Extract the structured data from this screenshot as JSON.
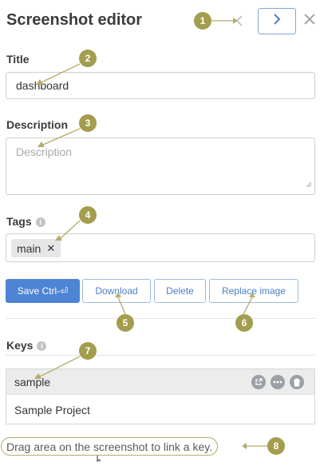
{
  "header": {
    "title": "Screenshot editor",
    "prev_icon": "chevron-left-icon",
    "next_icon": "chevron-right-icon",
    "close_icon": "close-icon"
  },
  "title_field": {
    "label": "Title",
    "value": "dashboard"
  },
  "description_field": {
    "label": "Description",
    "placeholder": "Description"
  },
  "tags": {
    "label": "Tags",
    "items": [
      {
        "label": "main"
      }
    ]
  },
  "actions": {
    "save": "Save Ctrl-⏎",
    "download": "Download",
    "delete": "Delete",
    "replace": "Replace image"
  },
  "keys": {
    "label": "Keys",
    "items": [
      {
        "name": "sample",
        "project": "Sample Project"
      }
    ]
  },
  "hint": "Drag area on the screenshot to link a key.",
  "callouts": [
    "1",
    "2",
    "3",
    "4",
    "5",
    "6",
    "7",
    "8"
  ],
  "colors": {
    "primary": "#4e84d4",
    "callout": "#a39d4e",
    "callout_line": "#b4ac6c"
  }
}
